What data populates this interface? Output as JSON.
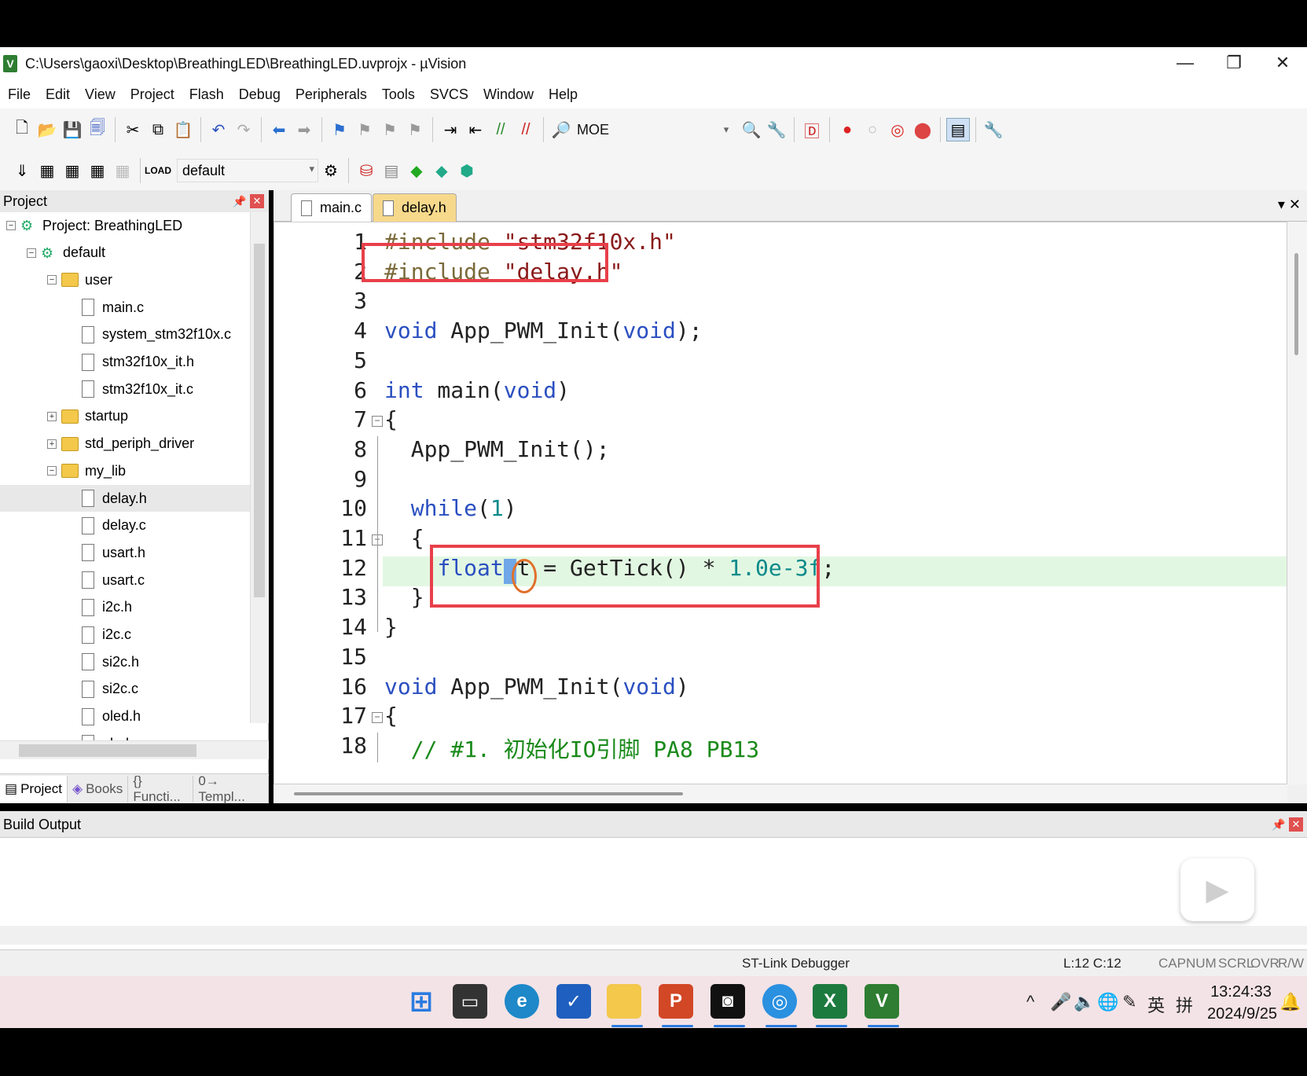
{
  "window": {
    "title": "C:\\Users\\gaoxi\\Desktop\\BreathingLED\\BreathingLED.uvprojx - µVision",
    "app_icon": "V",
    "minimize": "—",
    "restore": "❐",
    "close": "✕"
  },
  "menu": [
    "File",
    "Edit",
    "View",
    "Project",
    "Flash",
    "Debug",
    "Peripherals",
    "Tools",
    "SVCS",
    "Window",
    "Help"
  ],
  "toolbar1": {
    "find_text": "MOE"
  },
  "toolbar2": {
    "target": "default"
  },
  "project_panel": {
    "title": "Project",
    "tree": [
      {
        "label": "Project: BreathingLED",
        "kind": "project",
        "expander": "−"
      },
      {
        "label": "default",
        "kind": "target",
        "expander": "−"
      },
      {
        "label": "user",
        "kind": "folder",
        "expander": "−"
      },
      {
        "label": "main.c",
        "kind": "file"
      },
      {
        "label": "system_stm32f10x.c",
        "kind": "file"
      },
      {
        "label": "stm32f10x_it.h",
        "kind": "file"
      },
      {
        "label": "stm32f10x_it.c",
        "kind": "file"
      },
      {
        "label": "startup",
        "kind": "folder",
        "expander": "+"
      },
      {
        "label": "std_periph_driver",
        "kind": "folder",
        "expander": "+"
      },
      {
        "label": "my_lib",
        "kind": "folder",
        "expander": "−"
      },
      {
        "label": "delay.h",
        "kind": "file",
        "selected": true
      },
      {
        "label": "delay.c",
        "kind": "file"
      },
      {
        "label": "usart.h",
        "kind": "file"
      },
      {
        "label": "usart.c",
        "kind": "file"
      },
      {
        "label": "i2c.h",
        "kind": "file"
      },
      {
        "label": "i2c.c",
        "kind": "file"
      },
      {
        "label": "si2c.h",
        "kind": "file"
      },
      {
        "label": "si2c.c",
        "kind": "file"
      },
      {
        "label": "oled.h",
        "kind": "file"
      },
      {
        "label": "oled.c",
        "kind": "file"
      }
    ],
    "tabs": [
      "Project",
      "Books",
      "{} Functi...",
      "0→ Templ..."
    ]
  },
  "editor": {
    "tabs": [
      "main.c",
      "delay.h"
    ],
    "active_tab": "main.c",
    "controls": "▾  ✕",
    "lines": [
      [
        [
          "pp",
          "#include "
        ],
        [
          "str",
          "\"stm32f10x.h\""
        ]
      ],
      [
        [
          "pp",
          "#include "
        ],
        [
          "str",
          "\"delay.h\""
        ]
      ],
      [],
      [
        [
          "kw",
          "void"
        ],
        [
          "",
          " App_PWM_Init("
        ],
        [
          "kw",
          "void"
        ],
        [
          "",
          ");"
        ]
      ],
      [],
      [
        [
          "kw",
          "int"
        ],
        [
          "",
          " main("
        ],
        [
          "kw",
          "void"
        ],
        [
          "",
          ")"
        ]
      ],
      [
        [
          "",
          "{"
        ]
      ],
      [
        [
          "",
          "  App_PWM_Init();"
        ]
      ],
      [],
      [
        [
          "",
          "  "
        ],
        [
          "kw",
          "while"
        ],
        [
          "",
          "("
        ],
        [
          "num",
          "1"
        ],
        [
          "",
          ")"
        ]
      ],
      [
        [
          "",
          "  {"
        ]
      ],
      [
        [
          "",
          "    "
        ],
        [
          "kw",
          "float"
        ],
        [
          "",
          " t = GetTick() * "
        ],
        [
          "num",
          "1.0e-3f"
        ],
        [
          "",
          ";"
        ]
      ],
      [
        [
          "",
          "  }"
        ]
      ],
      [
        [
          "",
          "}"
        ]
      ],
      [],
      [
        [
          "kw",
          "void"
        ],
        [
          "",
          " App_PWM_Init("
        ],
        [
          "kw",
          "void"
        ],
        [
          "",
          ")"
        ]
      ],
      [
        [
          "",
          "{"
        ]
      ],
      [
        [
          "cmt",
          "  // #1. 初始化IO引脚 PA8 PB13"
        ]
      ]
    ]
  },
  "build_output": {
    "title": "Build Output"
  },
  "overlay": {
    "play_glyph": "▶"
  },
  "status": {
    "debugger": "ST-Link Debugger",
    "position": "L:12 C:12",
    "indicators": [
      "CAP",
      "NUM",
      "SCRL",
      "OVR",
      "R/W"
    ]
  },
  "taskbar": {
    "apps": [
      "start",
      "explorer-window",
      "edge",
      "whiteboard",
      "file-explorer",
      "powerpoint",
      "camera",
      "qq",
      "excel",
      "keil-uvision"
    ],
    "tray": {
      "chevron": "^",
      "ime_lang": "英",
      "ime_mode": "拼"
    },
    "time": "13:24:33",
    "date": "2024/9/25"
  },
  "colors": {
    "keyword": "#2a4fc0",
    "string": "#8a1a1a",
    "number": "#0a8a8a",
    "comment": "#1a8a1a",
    "highlight_box": "#e8404a",
    "current_line": "#e2f7e2"
  }
}
